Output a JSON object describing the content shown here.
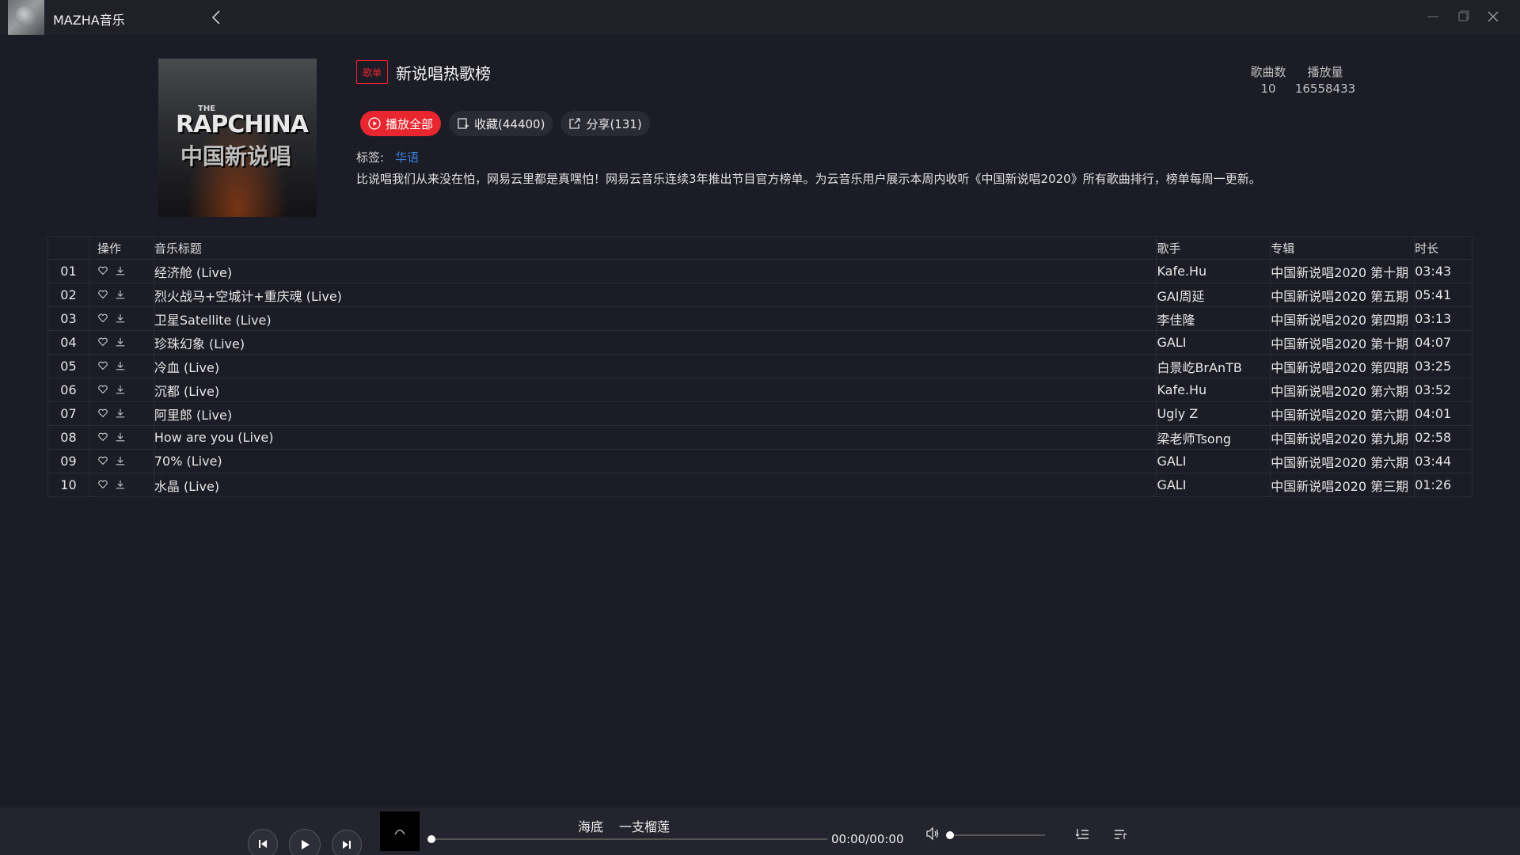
{
  "app": {
    "title": "MAZHA音乐"
  },
  "playlist": {
    "badge": "歌单",
    "title": "新说唱热歌榜",
    "stats": {
      "count_label": "歌曲数",
      "count_value": "10",
      "plays_label": "播放量",
      "plays_value": "16558433"
    },
    "actions": {
      "play_all": "播放全部",
      "collect": "收藏(44400)",
      "share": "分享(131)"
    },
    "tags_label": "标签:",
    "tags": [
      "华语"
    ],
    "description": "比说唱我们从来没在怕，网易云里都是真嘿怕！网易云音乐连续3年推出节目官方榜单。为云音乐用户展示本周内收听《中国新说唱2020》所有歌曲排行，榜单每周一更新。",
    "cover": {
      "line1": "THE",
      "line2": "RAPCHINA",
      "line3": "中国新说唱"
    }
  },
  "table": {
    "headers": {
      "ops": "操作",
      "title": "音乐标题",
      "artist": "歌手",
      "album": "专辑",
      "duration": "时长"
    },
    "rows": [
      {
        "idx": "01",
        "title": "经济舱 (Live)",
        "artist": "Kafe.Hu",
        "album": "中国新说唱2020 第十期",
        "duration": "03:43"
      },
      {
        "idx": "02",
        "title": "烈火战马+空城计+重庆魂 (Live)",
        "artist": "GAI周延",
        "album": "中国新说唱2020 第五期",
        "duration": "05:41"
      },
      {
        "idx": "03",
        "title": "卫星Satellite (Live)",
        "artist": "李佳隆",
        "album": "中国新说唱2020 第四期",
        "duration": "03:13"
      },
      {
        "idx": "04",
        "title": "珍珠幻象 (Live)",
        "artist": "GALI",
        "album": "中国新说唱2020 第十期",
        "duration": "04:07"
      },
      {
        "idx": "05",
        "title": "冷血 (Live)",
        "artist": "白景屹BrAnTB",
        "album": "中国新说唱2020 第四期",
        "duration": "03:25"
      },
      {
        "idx": "06",
        "title": "沉都 (Live)",
        "artist": "Kafe.Hu",
        "album": "中国新说唱2020 第六期",
        "duration": "03:52"
      },
      {
        "idx": "07",
        "title": "阿里郎 (Live)",
        "artist": "Ugly Z",
        "album": "中国新说唱2020 第六期",
        "duration": "04:01"
      },
      {
        "idx": "08",
        "title": "How are you (Live)",
        "artist": "梁老师Tsong",
        "album": "中国新说唱2020 第九期",
        "duration": "02:58"
      },
      {
        "idx": "09",
        "title": "70% (Live)",
        "artist": "GALI",
        "album": "中国新说唱2020 第六期",
        "duration": "03:44"
      },
      {
        "idx": "10",
        "title": "水晶 (Live)",
        "artist": "GALI",
        "album": "中国新说唱2020 第三期",
        "duration": "01:26"
      }
    ]
  },
  "player": {
    "song": "海底",
    "artist": "一支榴莲",
    "time": "00:00/00:00",
    "progress": 0,
    "volume": 0
  },
  "colors": {
    "accent": "#e8262f",
    "link": "#3a7fd5",
    "background": "#1c1c27"
  }
}
